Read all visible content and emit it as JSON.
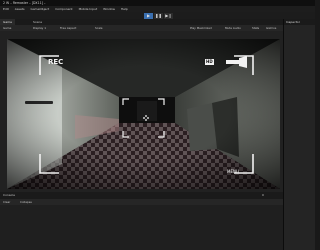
{
  "window": {
    "title": "2 W – Remaster – [DX11] –"
  },
  "menu": [
    "Edit",
    "Assets",
    "GameObject",
    "Component",
    "Mobile Input",
    "Window",
    "Help"
  ],
  "toolbar": {
    "play": "▶",
    "pause": "❚❚",
    "step": "▶❙"
  },
  "tabs": {
    "game": "Game",
    "scene": "Scene",
    "inspector": "Inspector"
  },
  "game_toolbar": {
    "mode": "Game",
    "display": "Display 1",
    "aspect": "Free Aspect",
    "scale": "Scale",
    "maximize": "Play Maximized",
    "mute": "Mute Audio",
    "stats": "Stats",
    "gizmos": "Gizmos"
  },
  "overlay": {
    "rec": "REC",
    "hd": "HD",
    "menu": "MENU"
  },
  "console": {
    "tab": "Console",
    "counts": "0",
    "collapse": "Collapse",
    "clear": "Clear"
  },
  "colors": {
    "accent": "#3a6fb0",
    "floor_dark": "#3a2a2e",
    "floor_light": "#9a8a8c"
  }
}
